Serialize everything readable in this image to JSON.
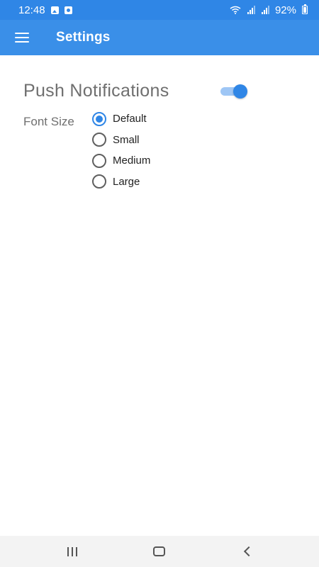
{
  "status_bar": {
    "time": "12:48",
    "battery": "92%",
    "icons": [
      "gallery-notification-icon",
      "message-notification-icon",
      "wifi-icon",
      "signal-icon",
      "signal-icon",
      "battery-icon"
    ]
  },
  "app_bar": {
    "title": "Settings",
    "menu_icon": "hamburger-menu-icon",
    "color": "#3a8fe8"
  },
  "settings": {
    "push_notifications": {
      "label": "Push Notifications",
      "enabled": true
    },
    "font_size": {
      "label": "Font Size",
      "selected": "Default",
      "options": [
        "Default",
        "Small",
        "Medium",
        "Large"
      ]
    }
  },
  "nav_bar": {
    "icons": [
      "recents-icon",
      "home-icon",
      "back-icon"
    ]
  },
  "colors": {
    "accent": "#2f86e6",
    "toggle_track": "#9ec6f5"
  }
}
